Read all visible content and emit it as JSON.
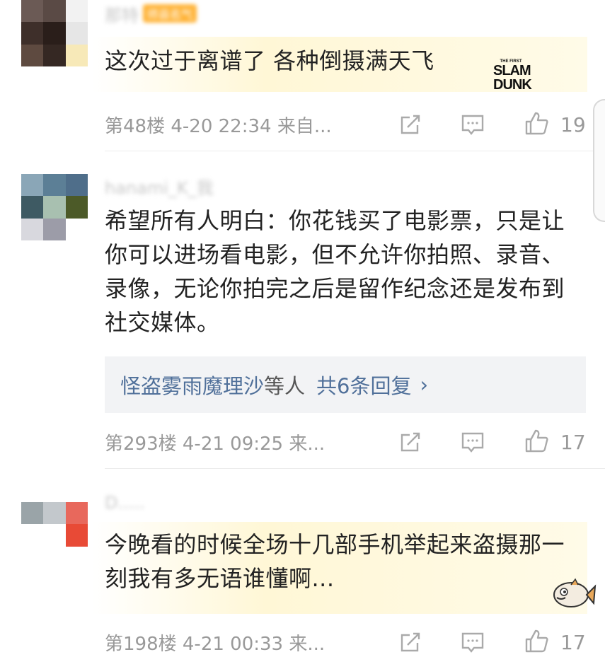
{
  "comments": [
    {
      "username": "那特",
      "badge": "师县名气",
      "text": "这次过于离谱了 各种倒摄满天飞",
      "sticker": {
        "line1": "THE FIRST",
        "line2": "SLAM",
        "line3": "DUNK"
      },
      "meta": "第48楼 4-20 22:34 来自...",
      "likes": "19",
      "avatar_colors": [
        "#6b5a55",
        "#5a4a45",
        "#f2f2f2",
        "#3e2f2a",
        "#2a1e1a",
        "#e6e6e6",
        "#5e4a40",
        "#352823",
        "#f7e9b8"
      ]
    },
    {
      "username": "hanami_K_我",
      "text": "希望所有人明白：你花钱买了电影票，只是让你可以进场看电影，但不允许你拍照、录音、录像，无论你拍完之后是留作纪念还是发布到社交媒体。",
      "replies": {
        "names": "怪盗雾雨魔理沙",
        "etc": "等人",
        "count": "共6条回复",
        "chevron": "›"
      },
      "meta": "第293楼 4-21 09:25 来...",
      "likes": "17",
      "avatar_colors": [
        "#8aa6b7",
        "#5c7f96",
        "#4f6e8a",
        "#3e5a63",
        "#a8c0b0",
        "#4c5a28",
        "#d8d8de",
        "#9c9ca8",
        "#ffffff"
      ]
    },
    {
      "username": "D.....",
      "text": "今晚看的时候全场十几部手机举起来盗摄那一刻我有多无语谁懂啊...",
      "meta": "第198楼 4-21 00:33 来...",
      "likes": "17",
      "avatar_colors": [
        "#9aa4a8",
        "#c3c8cc",
        "#e8685c",
        "#ffffff",
        "#ffffff",
        "#e84a36",
        "#ffffff",
        "#ffffff",
        "#ffffff"
      ]
    }
  ]
}
